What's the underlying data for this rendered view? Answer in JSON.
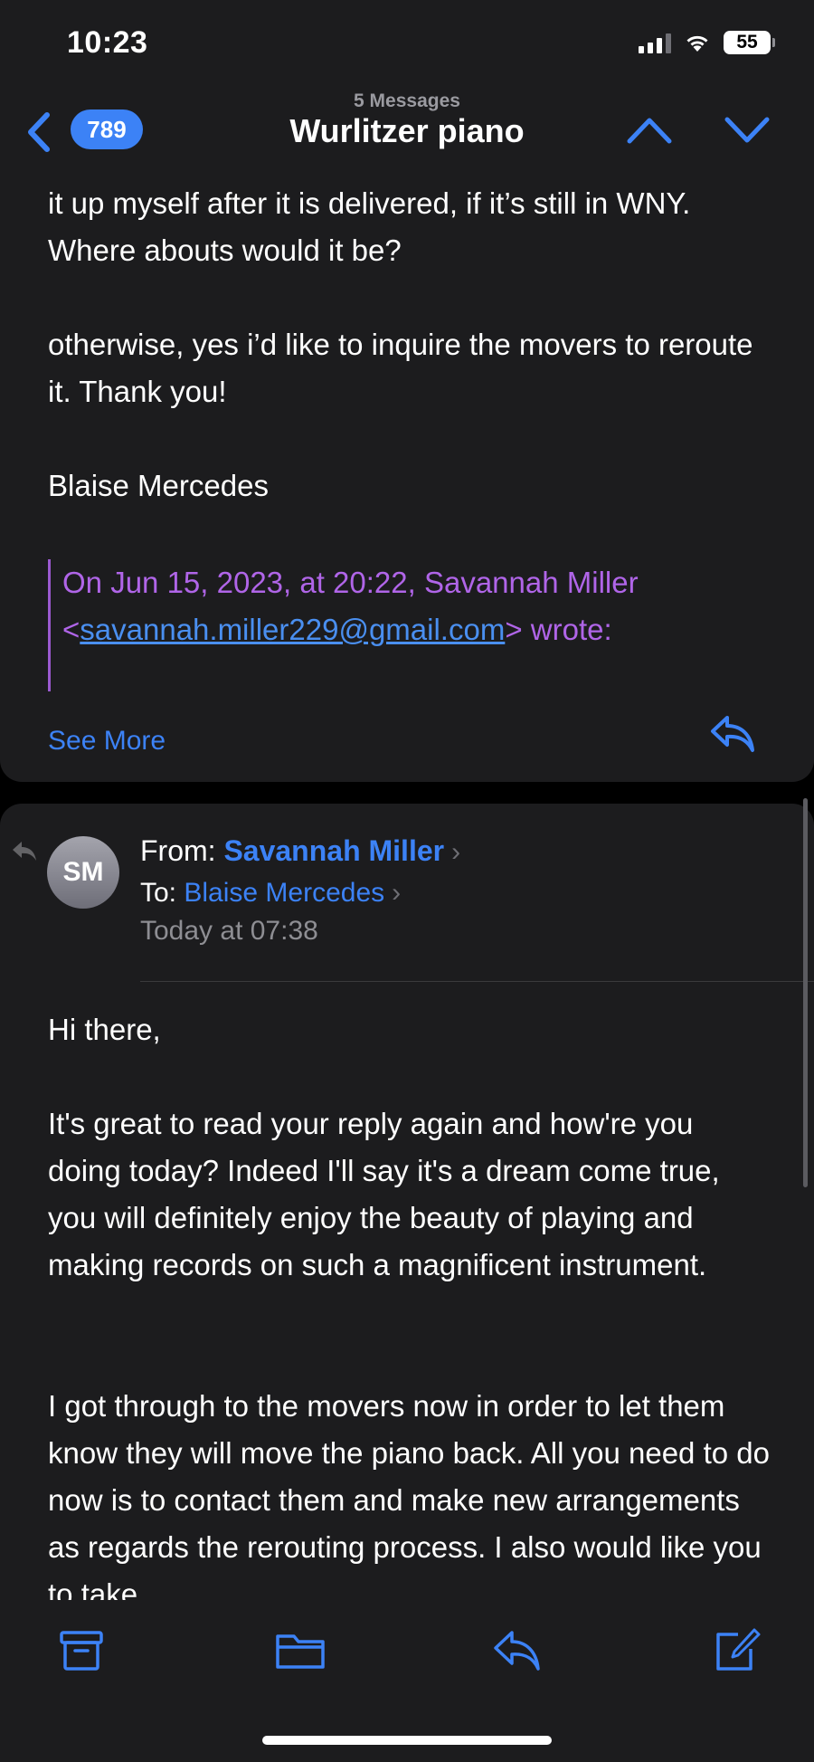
{
  "status_bar": {
    "time": "10:23",
    "battery": "55"
  },
  "nav": {
    "unread_count": "789",
    "subtitle": "5 Messages",
    "title": "Wurlitzer piano"
  },
  "message1": {
    "paragraph1": "it up myself after it is delivered, if it’s still in WNY. Where abouts would it be?",
    "paragraph2": "otherwise, yes i’d like to inquire the movers to reroute it. Thank you!",
    "signature": "Blaise Mercedes",
    "quote_prefix": "On Jun 15, 2023, at 20:22, Savannah Miller",
    "quote_lt": "<",
    "quote_email": "savannah.miller229@gmail.com",
    "quote_suffix": "> wrote:",
    "see_more": "See More"
  },
  "message2": {
    "avatar_initials": "SM",
    "from_label": "From:",
    "from_name": "Savannah Miller",
    "to_label": "To:",
    "to_name": "Blaise Mercedes",
    "date": "Today at 07:38",
    "greeting": "Hi there,",
    "paragraph1": "It's great to read your reply again and how're you doing today? Indeed I'll say it's a dream come true, you will definitely enjoy the beauty of playing and making records on such a magnificent instrument.",
    "paragraph2": "I got through to the movers now in order to let them know they will move the piano back. All you need to do now is to contact them and make new arrangements as regards the rerouting process. I also would like you to take"
  },
  "colors": {
    "accent": "#3c82f6",
    "quote": "#b065e8",
    "background": "#1c1c1e"
  },
  "icons": {
    "toolbar": [
      "archive-icon",
      "folder-icon",
      "reply-icon",
      "compose-icon"
    ]
  }
}
